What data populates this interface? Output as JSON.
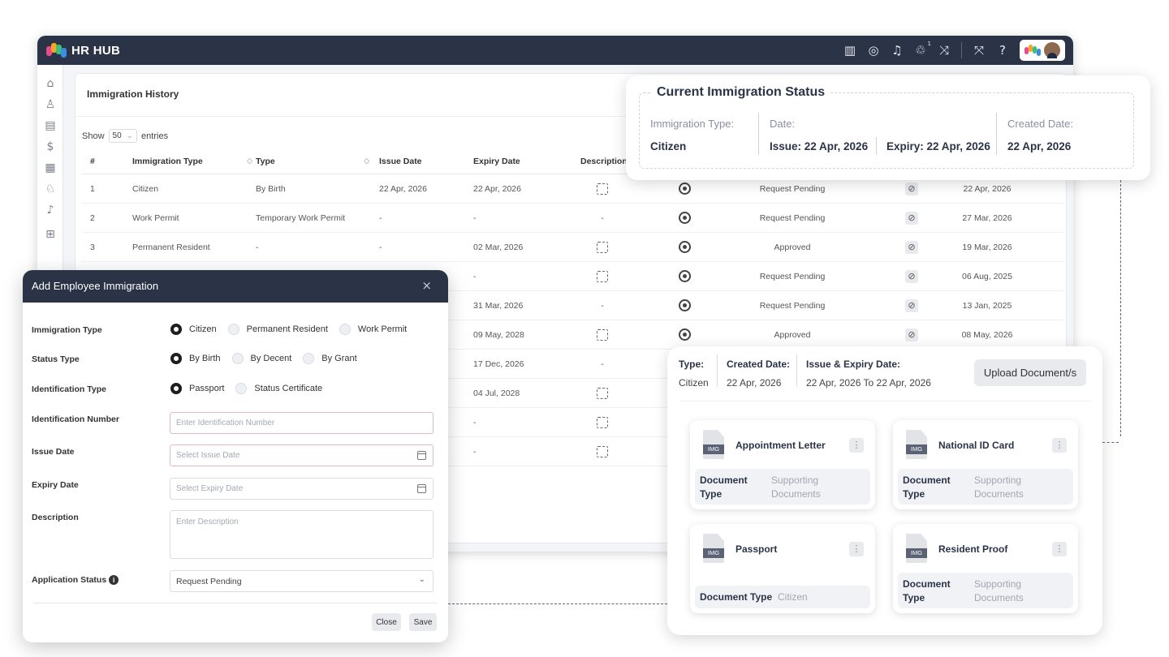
{
  "app": {
    "title": "HR HUB",
    "notification_count": "1",
    "topbar_icons": [
      "calendar-book-icon",
      "chat-icon",
      "bell-icon",
      "recycle-icon",
      "shuffle-icon",
      "fullscreen-icon",
      "help-icon"
    ]
  },
  "sidebar": {
    "icons": [
      "home-icon",
      "users-icon",
      "id-card-icon",
      "dollar-icon",
      "chart-icon",
      "bike-icon",
      "bell-icon",
      "grid-icon"
    ]
  },
  "history": {
    "title": "Immigration History",
    "show_label": "Show",
    "show_value": "50",
    "entries_label": "entries",
    "columns": [
      "#",
      "Immigration Type",
      "Type",
      "Issue Date",
      "Expiry Date",
      "Description"
    ],
    "rows": [
      {
        "num": "1",
        "immigration_type": "Citizen",
        "type": "By Birth",
        "issue": "22 Apr, 2026",
        "expiry": "22 Apr, 2026",
        "desc": "expand",
        "status": "Request Pending",
        "created": "22 Apr, 2026"
      },
      {
        "num": "2",
        "immigration_type": "Work Permit",
        "type": "Temporary Work Permit",
        "issue": "-",
        "expiry": "-",
        "desc": "-",
        "status": "Request Pending",
        "created": "27 Mar, 2026"
      },
      {
        "num": "3",
        "immigration_type": "Permanent Resident",
        "type": "-",
        "issue": "-",
        "expiry": "02 Mar, 2026",
        "desc": "expand",
        "status": "Approved",
        "created": "19 Mar, 2026"
      },
      {
        "num": "",
        "immigration_type": "",
        "type": "",
        "issue": "",
        "expiry": "-",
        "desc": "expand",
        "status": "Request Pending",
        "created": "06 Aug, 2025"
      },
      {
        "num": "",
        "immigration_type": "",
        "type": "",
        "issue": "",
        "expiry": "31 Mar, 2026",
        "desc": "-",
        "status": "Request Pending",
        "created": "13 Jan, 2025"
      },
      {
        "num": "",
        "immigration_type": "",
        "type": "",
        "issue": "",
        "expiry": "09 May, 2028",
        "desc": "expand",
        "status": "Approved",
        "created": "08 May, 2026"
      },
      {
        "num": "",
        "immigration_type": "",
        "type": "",
        "issue": "",
        "expiry": "17 Dec, 2026",
        "desc": "-",
        "status": "",
        "created": ""
      },
      {
        "num": "",
        "immigration_type": "",
        "type": "",
        "issue": "",
        "expiry": "04 Jul, 2028",
        "desc": "expand",
        "status": "",
        "created": ""
      },
      {
        "num": "",
        "immigration_type": "",
        "type": "",
        "issue": "",
        "expiry": "-",
        "desc": "expand",
        "status": "",
        "created": ""
      },
      {
        "num": "",
        "immigration_type": "",
        "type": "",
        "issue": "",
        "expiry": "-",
        "desc": "expand",
        "status": "",
        "created": ""
      }
    ]
  },
  "status_card": {
    "title": "Current Immigration Status",
    "type_label": "Immigration Type:",
    "type_value": "Citizen",
    "date_label": "Date:",
    "issue_value": "Issue: 22 Apr, 2026",
    "expiry_value": "Expiry: 22 Apr, 2026",
    "created_label": "Created Date:",
    "created_value": "22 Apr, 2026"
  },
  "dialog": {
    "title": "Add Employee Immigration",
    "close_glyph": "×",
    "immigration_type": {
      "label": "Immigration Type",
      "options": [
        "Citizen",
        "Permanent Resident",
        "Work Permit"
      ],
      "selected": "Citizen"
    },
    "status_type": {
      "label": "Status Type",
      "options": [
        "By Birth",
        "By Decent",
        "By Grant"
      ],
      "selected": "By Birth"
    },
    "identification_type": {
      "label": "Identification Type",
      "options": [
        "Passport",
        "Status Certificate"
      ],
      "selected": "Passport"
    },
    "identification_number": {
      "label": "Identification Number",
      "placeholder": "Enter Identification Number"
    },
    "issue_date": {
      "label": "Issue Date",
      "placeholder": "Select Issue Date"
    },
    "expiry_date": {
      "label": "Expiry Date",
      "placeholder": "Select Expiry Date"
    },
    "description": {
      "label": "Description",
      "placeholder": "Enter Description"
    },
    "application_status": {
      "label": "Application Status",
      "value": "Request Pending"
    },
    "close_label": "Close",
    "save_label": "Save"
  },
  "documents": {
    "type_label": "Type:",
    "type_value": "Citizen",
    "created_label": "Created Date:",
    "created_value": "22 Apr, 2026",
    "range_label": "Issue & Expiry Date:",
    "range_value": "22 Apr, 2026 To 22 Apr, 2026",
    "upload_label": "Upload Document/s",
    "file_tag": "IMG",
    "tiles": [
      {
        "name": "Appointment Letter",
        "meta_key": "Document Type",
        "meta_value": "Supporting Documents"
      },
      {
        "name": "National ID Card",
        "meta_key": "Document Type",
        "meta_value": "Supporting Documents"
      },
      {
        "name": "Passport",
        "meta_key": "Document Type",
        "meta_value": "Citizen"
      },
      {
        "name": "Resident Proof",
        "meta_key": "Document Type",
        "meta_value": "Supporting Documents"
      }
    ]
  }
}
